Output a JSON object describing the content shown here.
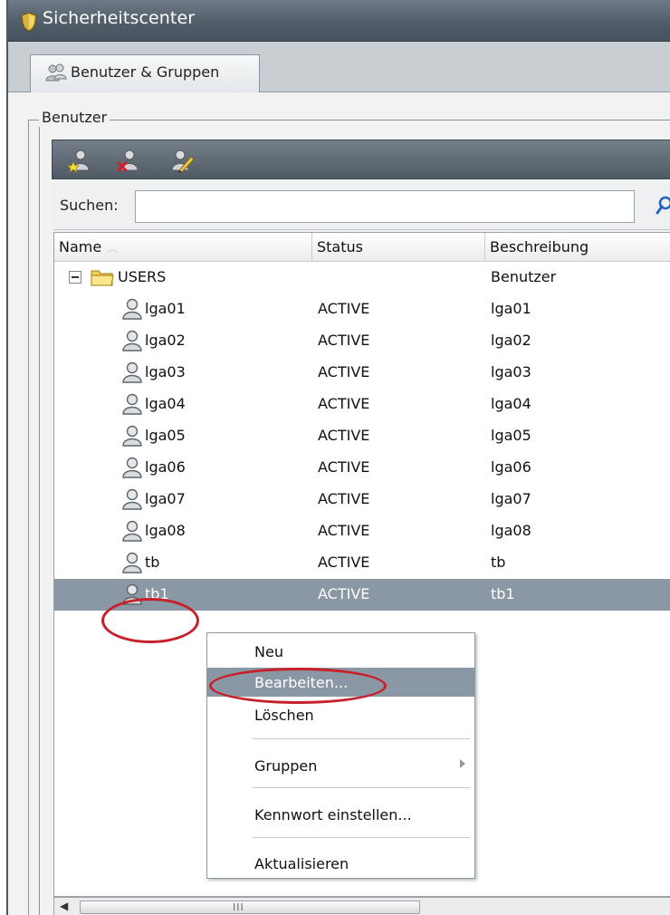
{
  "window": {
    "title": "Sicherheitscenter"
  },
  "tabs": [
    {
      "label": "Benutzer & Gruppen"
    }
  ],
  "group": {
    "legend": "Benutzer"
  },
  "toolbar": {
    "buttons": [
      "add-user-icon",
      "delete-user-icon",
      "edit-user-icon"
    ]
  },
  "search": {
    "label": "Suchen:",
    "value": "",
    "placeholder": ""
  },
  "table": {
    "columns": [
      "Name",
      "Status",
      "Beschreibung"
    ],
    "folder": {
      "name": "USERS",
      "status": "",
      "description": "Benutzer"
    },
    "rows": [
      {
        "name": "lga01",
        "status": "ACTIVE",
        "description": "lga01"
      },
      {
        "name": "lga02",
        "status": "ACTIVE",
        "description": "lga02"
      },
      {
        "name": "lga03",
        "status": "ACTIVE",
        "description": "lga03"
      },
      {
        "name": "lga04",
        "status": "ACTIVE",
        "description": "lga04"
      },
      {
        "name": "lga05",
        "status": "ACTIVE",
        "description": "lga05"
      },
      {
        "name": "lga06",
        "status": "ACTIVE",
        "description": "lga06"
      },
      {
        "name": "lga07",
        "status": "ACTIVE",
        "description": "lga07"
      },
      {
        "name": "lga08",
        "status": "ACTIVE",
        "description": "lga08"
      },
      {
        "name": "tb",
        "status": "ACTIVE",
        "description": "tb"
      },
      {
        "name": "tb1",
        "status": "ACTIVE",
        "description": "tb1"
      }
    ],
    "selected_row": "tb1"
  },
  "context_menu": {
    "items": [
      {
        "label": "Neu"
      },
      {
        "label": "Bearbeiten..."
      },
      {
        "label": "Löschen"
      },
      {
        "label": "Gruppen"
      },
      {
        "label": "Kennwort einstellen..."
      },
      {
        "label": "Aktualisieren"
      }
    ],
    "highlighted": "Bearbeiten..."
  },
  "colors": {
    "selection": "#8a98a6",
    "annotation_ring": "#c8202a",
    "titlebar": "#5a6672"
  }
}
